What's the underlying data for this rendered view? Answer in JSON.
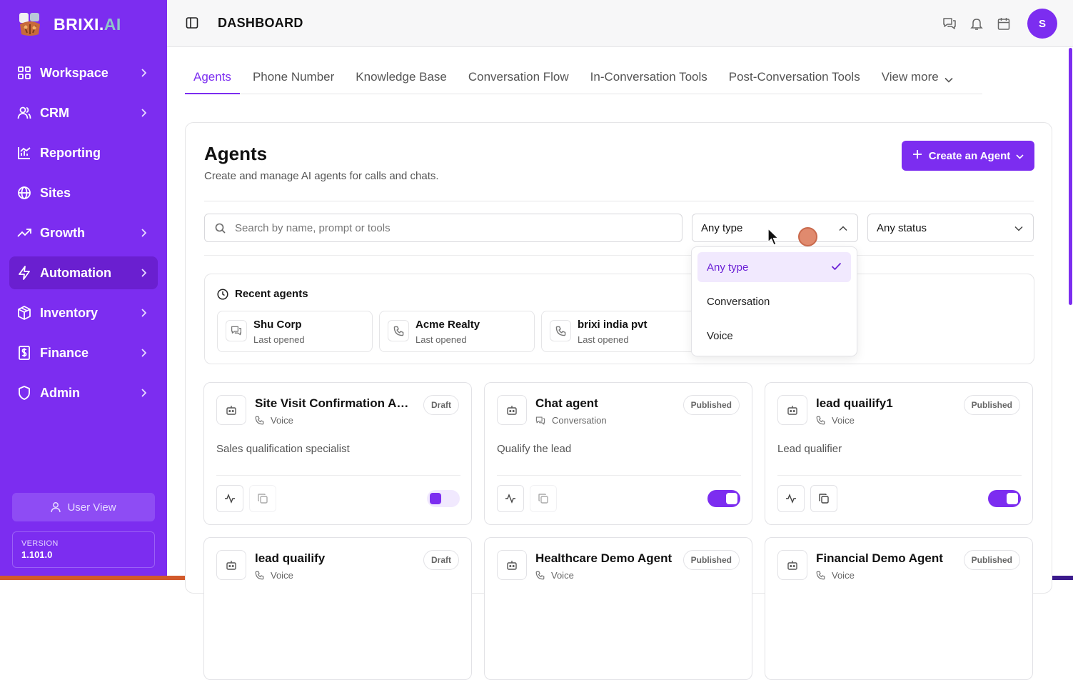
{
  "brand": {
    "name_main": "BRIXI.",
    "name_accent": "AI"
  },
  "sidebar": {
    "items": [
      {
        "label": "Workspace",
        "icon": "grid-icon",
        "chevron": true,
        "active": false
      },
      {
        "label": "CRM",
        "icon": "users-icon",
        "chevron": true,
        "active": false
      },
      {
        "label": "Reporting",
        "icon": "chart-icon",
        "chevron": false,
        "active": false
      },
      {
        "label": "Sites",
        "icon": "globe-icon",
        "chevron": false,
        "active": false
      },
      {
        "label": "Growth",
        "icon": "trend-icon",
        "chevron": true,
        "active": false
      },
      {
        "label": "Automation",
        "icon": "bolt-icon",
        "chevron": true,
        "active": true
      },
      {
        "label": "Inventory",
        "icon": "box-icon",
        "chevron": true,
        "active": false
      },
      {
        "label": "Finance",
        "icon": "dollar-file-icon",
        "chevron": true,
        "active": false
      },
      {
        "label": "Admin",
        "icon": "shield-icon",
        "chevron": true,
        "active": false
      }
    ],
    "user_view": "User View",
    "version_label": "VERSION",
    "version_value": "1.101.0"
  },
  "header": {
    "title": "DASHBOARD",
    "avatar_initial": "S"
  },
  "tabs": [
    {
      "label": "Agents",
      "active": true
    },
    {
      "label": "Phone Number",
      "active": false
    },
    {
      "label": "Knowledge Base",
      "active": false
    },
    {
      "label": "Conversation Flow",
      "active": false
    },
    {
      "label": "In-Conversation Tools",
      "active": false
    },
    {
      "label": "Post-Conversation Tools",
      "active": false
    },
    {
      "label": "View more",
      "active": false
    }
  ],
  "page": {
    "title": "Agents",
    "subtitle": "Create and manage AI agents for calls and chats.",
    "create_button": "Create an Agent"
  },
  "filters": {
    "search_placeholder": "Search by name, prompt or tools",
    "type_value": "Any type",
    "status_value": "Any status",
    "type_options": [
      {
        "label": "Any type",
        "selected": true
      },
      {
        "label": "Conversation",
        "selected": false
      },
      {
        "label": "Voice",
        "selected": false
      }
    ]
  },
  "recent": {
    "heading": "Recent agents",
    "items": [
      {
        "name": "Shu Corp",
        "sub": "Last opened",
        "icon": "chat-icon"
      },
      {
        "name": "Acme Realty",
        "sub": "Last opened",
        "icon": "phone-icon"
      },
      {
        "name": "brixi india pvt",
        "sub": "Last opened",
        "icon": "phone-icon"
      }
    ]
  },
  "agents": [
    {
      "name": "Site Visit Confirmation Ag...",
      "type": "Voice",
      "status": "Draft",
      "desc": "Sales qualification specialist",
      "enabled": false
    },
    {
      "name": "Chat agent",
      "type": "Conversation",
      "status": "Published",
      "desc": "Qualify the lead",
      "enabled": true
    },
    {
      "name": "lead quailify1",
      "type": "Voice",
      "status": "Published",
      "desc": "Lead qualifier",
      "enabled": true
    },
    {
      "name": "lead quailify",
      "type": "Voice",
      "status": "Draft",
      "desc": "",
      "enabled": false
    },
    {
      "name": "Healthcare Demo Agent",
      "type": "Voice",
      "status": "Published",
      "desc": "",
      "enabled": true
    },
    {
      "name": "Financial Demo Agent",
      "type": "Voice",
      "status": "Published",
      "desc": "",
      "enabled": true
    }
  ],
  "colors": {
    "brand": "#7c2df0",
    "active_nav": "#6a1fd0"
  }
}
